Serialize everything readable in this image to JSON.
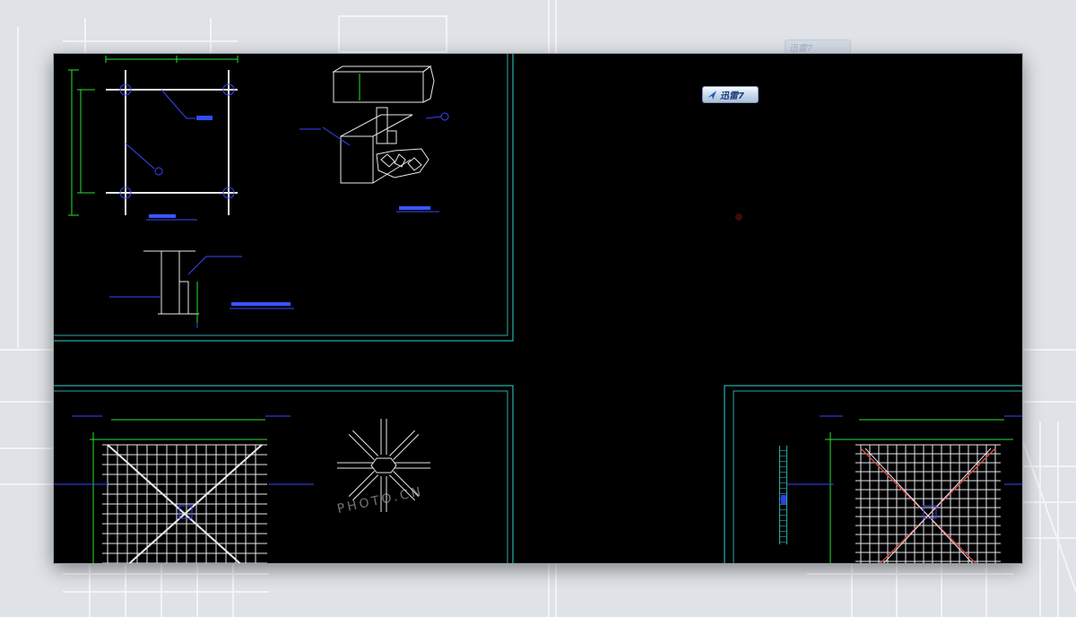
{
  "taskbar_button": {
    "label": "迅雷7",
    "icon": "xunlei-bird-icon"
  },
  "background_taskbar_button": {
    "label": "迅雷7"
  },
  "watermark": {
    "text": "PHOTO.CN"
  },
  "colors": {
    "viewport_background": "#000000",
    "sheet_border": "#2fd3d3",
    "geometry": "#e8e8e8",
    "dimensions": "#2de02d",
    "leaders": "#3a46ff",
    "diagonal_highlight": "#e24d4d",
    "page_background": "#dfe2e6"
  }
}
